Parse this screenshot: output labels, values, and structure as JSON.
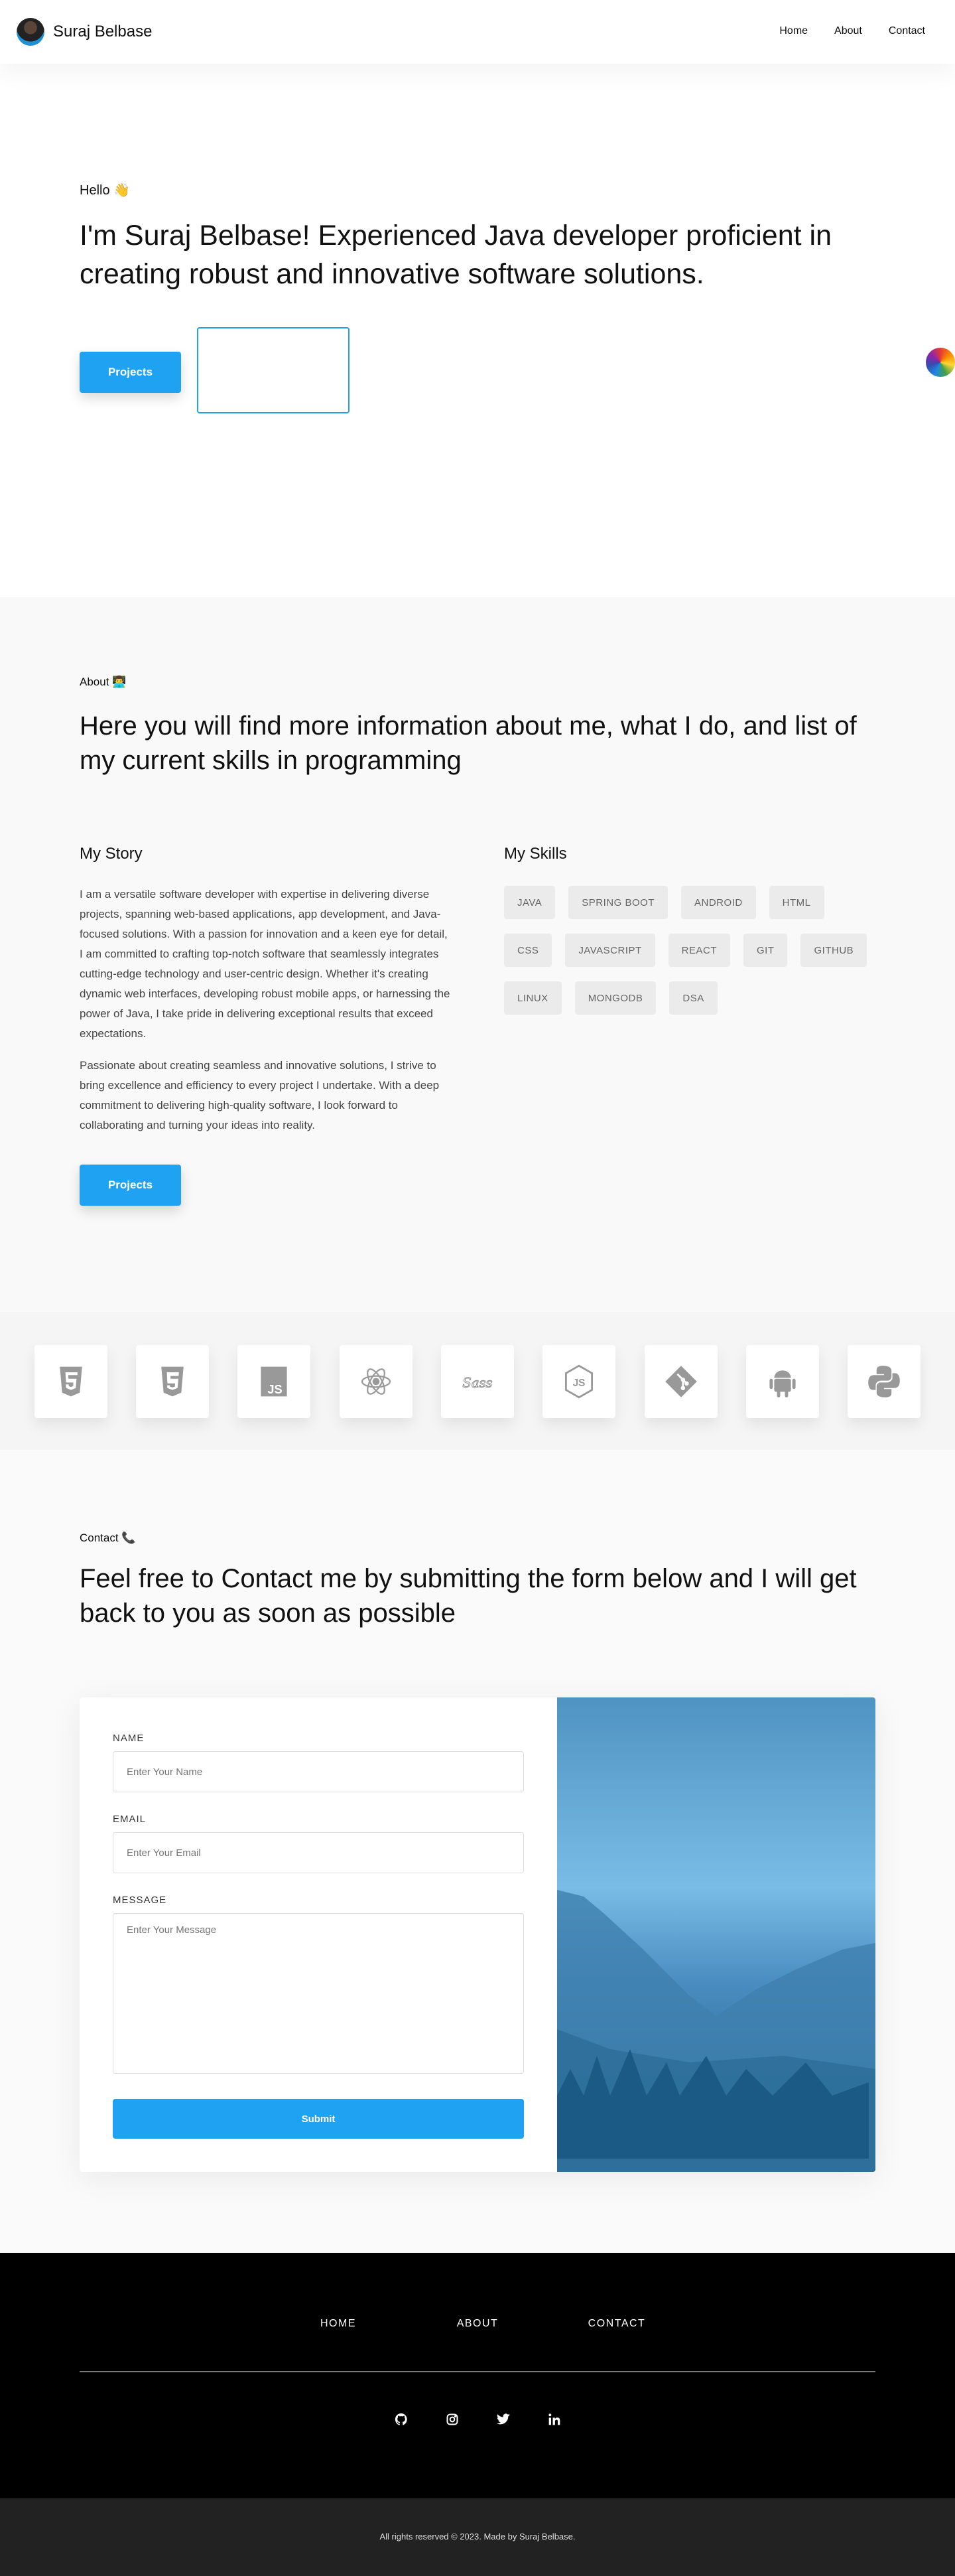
{
  "nav": {
    "brand": "Suraj Belbase",
    "links": [
      "Home",
      "About",
      "Contact"
    ]
  },
  "hero": {
    "greeting": "Hello 👋",
    "headline": "I'm Suraj Belbase! Experienced Java developer proficient in creating robust and innovative software solutions.",
    "projects_button": "Projects"
  },
  "about": {
    "label": "About 👨‍💻",
    "heading": "Here you will find more information about me, what I do, and list of my current skills in programming",
    "story_title": "My Story",
    "story": [
      "I am a versatile software developer with expertise in delivering diverse projects, spanning web-based applications, app development, and Java-focused solutions. With a passion for innovation and a keen eye for detail, I am committed to crafting top-notch software that seamlessly integrates cutting-edge technology and user-centric design. Whether it's creating dynamic web interfaces, developing robust mobile apps, or harnessing the power of Java, I take pride in delivering exceptional results that exceed expectations.",
      "Passionate about creating seamless and innovative solutions, I strive to bring excellence and efficiency to every project I undertake. With a deep commitment to delivering high-quality software, I look forward to collaborating and turning your ideas into reality."
    ],
    "projects_button": "Projects",
    "skills_title": "My Skills",
    "skills": [
      "JAVA",
      "SPRING BOOT",
      "ANDROID",
      "HTML",
      "CSS",
      "JAVASCRIPT",
      "REACT",
      "GIT",
      "GITHUB",
      "LINUX",
      "MONGODB",
      "DSA"
    ]
  },
  "tech_icons": [
    "html5-icon",
    "css3-icon",
    "javascript-icon",
    "react-icon",
    "sass-icon",
    "nodejs-icon",
    "git-icon",
    "android-icon",
    "python-icon"
  ],
  "contact": {
    "label": "Contact 📞",
    "heading": "Feel free to Contact me by submitting the form below and I will get back to you as soon as possible",
    "name_label": "NAME",
    "name_placeholder": "Enter Your Name",
    "email_label": "EMAIL",
    "email_placeholder": "Enter Your Email",
    "message_label": "MESSAGE",
    "message_placeholder": "Enter Your Message",
    "submit": "Submit"
  },
  "footer": {
    "links": [
      "HOME",
      "ABOUT",
      "CONTACT"
    ],
    "social": [
      "github-icon",
      "instagram-icon",
      "twitter-icon",
      "linkedin-icon"
    ],
    "copyright": "All rights reserved © 2023. Made by Suraj Belbase."
  },
  "colors": {
    "accent": "#1ea2f1",
    "footer": "#000000",
    "bottom": "#222222"
  }
}
